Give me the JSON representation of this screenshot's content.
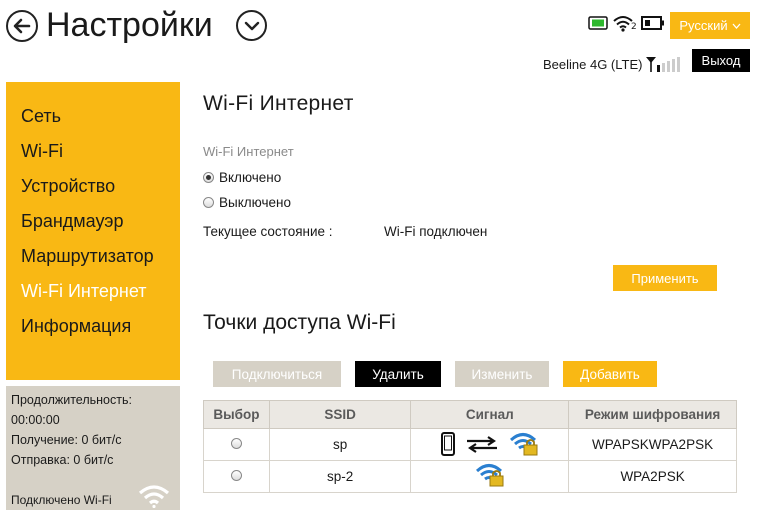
{
  "header": {
    "title": "Настройки",
    "language": "Русский",
    "logout": "Выход",
    "operator": "Beeline 4G (LTE)",
    "wifi_clients": "2"
  },
  "sidebar": {
    "items": [
      {
        "label": "Сеть"
      },
      {
        "label": "Wi-Fi"
      },
      {
        "label": "Устройство"
      },
      {
        "label": "Брандмауэр"
      },
      {
        "label": "Маршрутизатор"
      },
      {
        "label": "Wi-Fi  Интернет"
      },
      {
        "label": "Информация"
      }
    ],
    "active_index": 5
  },
  "stats": {
    "duration_label": "Продолжительность:",
    "duration_value": "00:00:00",
    "received": "Получение: 0 бит/с",
    "sent": "Отправка: 0 бит/с",
    "connected": "Подключено Wi-Fi"
  },
  "main": {
    "title": "Wi-Fi  Интернет",
    "field_label": "Wi-Fi Интернет",
    "option_on": "Включено",
    "option_off": "Выключено",
    "selected": "on",
    "state_label": "Текущее состояние :",
    "state_value": "Wi-Fi подключен",
    "apply": "Применить"
  },
  "access_points": {
    "title": "Точки доступа Wi-Fi",
    "buttons": {
      "connect": "Подключиться",
      "delete": "Удалить",
      "edit": "Изменить",
      "add": "Добавить"
    },
    "columns": [
      "Выбор",
      "SSID",
      "Сигнал",
      "Режим шифрования"
    ],
    "rows": [
      {
        "ssid": "sp",
        "encryption": "WPAPSKWPA2PSK",
        "connected": true
      },
      {
        "ssid": "sp-2",
        "encryption": "WPA2PSK",
        "connected": false
      }
    ]
  },
  "colors": {
    "accent": "#f9b814",
    "panel_gray": "#d6d1c6",
    "black": "#000000"
  }
}
